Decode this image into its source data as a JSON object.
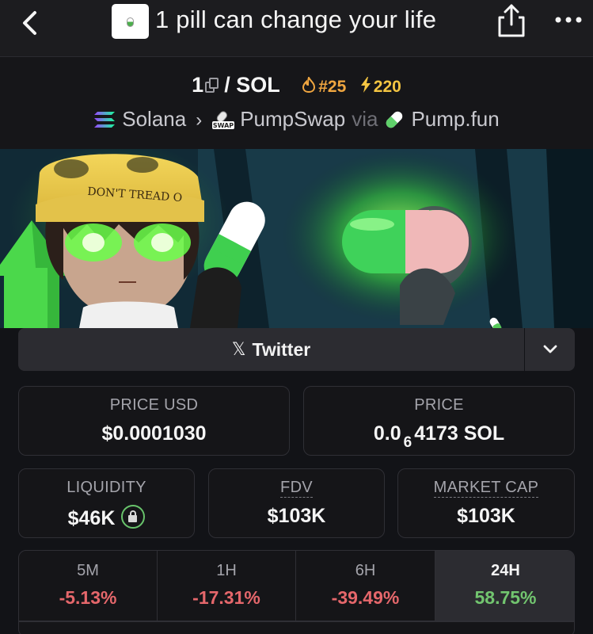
{
  "nav": {
    "title": "1 pill can change your life"
  },
  "token": {
    "symbol": "1",
    "pair": "/ SOL",
    "rank": "#25",
    "boosts": "220",
    "chain": "Solana",
    "dex": "PumpSwap",
    "via": "via",
    "launchpad": "Pump.fun",
    "dex_badge_text": "SWAP"
  },
  "banner": {
    "hat_text": "DON'T TREAD O"
  },
  "links": {
    "twitter_label": "Twitter",
    "twitter_icon": "x-logo-icon"
  },
  "stats": {
    "price_usd_label": "PRICE USD",
    "price_usd": "$0.0001030",
    "price_label": "PRICE",
    "price_sol_prefix": "0.0",
    "price_sol_zeros": "6",
    "price_sol_suffix": "4173 SOL",
    "liquidity_label": "LIQUIDITY",
    "liquidity": "$46K",
    "fdv_label": "FDV",
    "fdv": "$103K",
    "mcap_label": "MARKET CAP",
    "mcap": "$103K"
  },
  "timeframes": [
    {
      "label": "5M",
      "change": "-5.13%",
      "direction": "down"
    },
    {
      "label": "1H",
      "change": "-17.31%",
      "direction": "down"
    },
    {
      "label": "6H",
      "change": "-39.49%",
      "direction": "down"
    },
    {
      "label": "24H",
      "change": "58.75%",
      "direction": "up",
      "active": true
    }
  ],
  "colors": {
    "accent_green": "#72c56f",
    "negative_red": "#e5676b",
    "rank_orange": "#f0a640",
    "boost_yellow": "#f4c542"
  }
}
